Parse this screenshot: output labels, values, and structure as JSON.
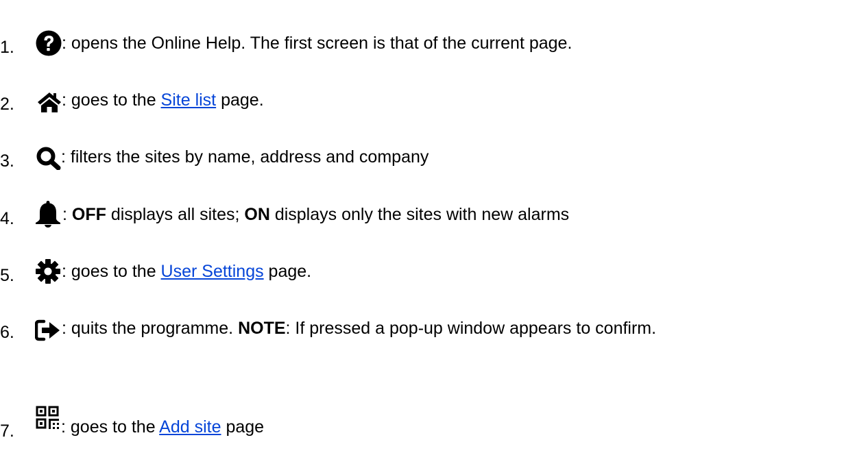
{
  "items": [
    {
      "number": "1.",
      "icon": "question-circle-icon",
      "text": ": opens the Online Help. The first screen is that of the current page."
    },
    {
      "number": "2.",
      "icon": "home-icon",
      "before": ": goes to the ",
      "link": "Site list",
      "after": " page."
    },
    {
      "number": "3.",
      "icon": "search-icon",
      "text": ": filters the sites by name, address and company"
    },
    {
      "number": "4.",
      "icon": "bell-icon",
      "before": ": ",
      "bold1": "OFF",
      "middle": " displays all sites; ",
      "bold2": "ON",
      "after": " displays only the sites with new alarms"
    },
    {
      "number": "5.",
      "icon": "gear-icon",
      "before": ": goes to the ",
      "link": "User Settings",
      "after": " page."
    },
    {
      "number": "6.",
      "icon": "sign-out-icon",
      "before": ": quits the programme. ",
      "bold1": "NOTE",
      "after": ": If pressed a pop-up window appears to confirm."
    },
    {
      "number": "7.",
      "icon": "qr-code-icon",
      "before": ": goes to the ",
      "link": "Add site",
      "after": " page"
    }
  ],
  "colors": {
    "text": "#000000",
    "link": "#0645d8",
    "icon": "#000000"
  }
}
